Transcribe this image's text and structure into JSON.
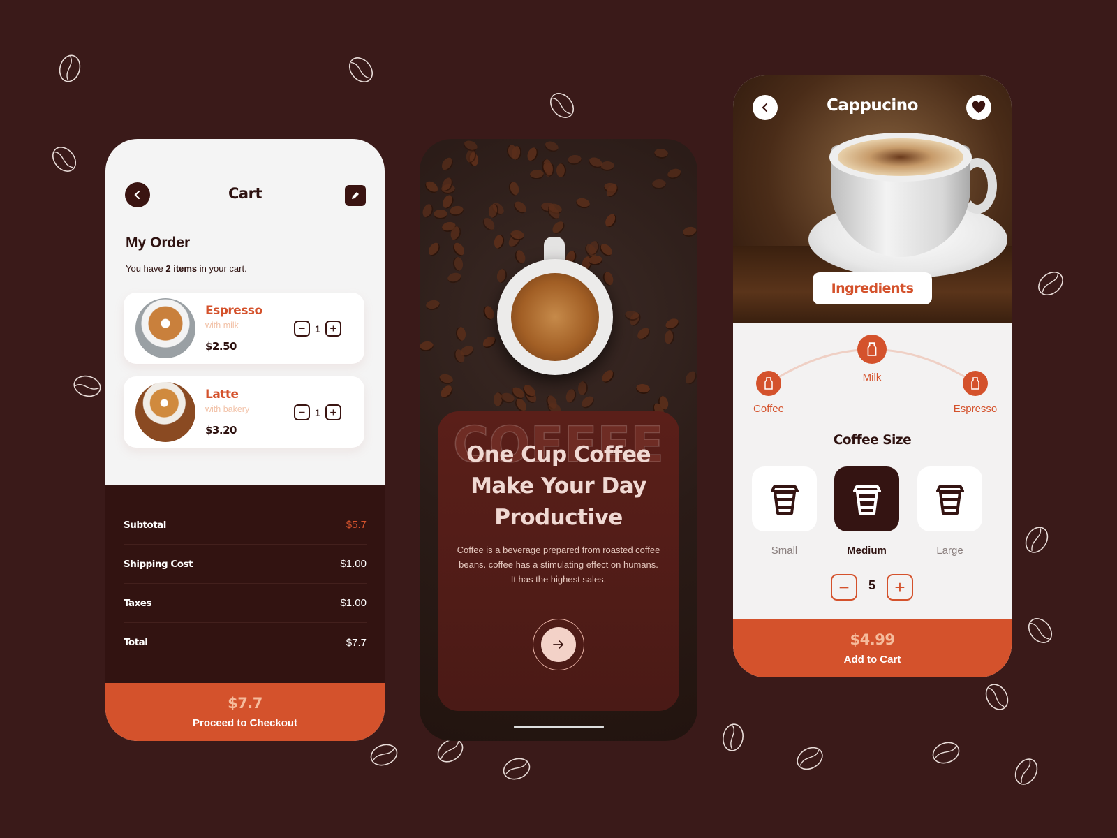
{
  "colors": {
    "background": "#3a1a19",
    "accent": "#d4522c",
    "dark": "#321311",
    "peach": "#f5bb9c"
  },
  "cart": {
    "title": "Cart",
    "back_icon": "chevron-left-icon",
    "edit_icon": "pencil-icon",
    "heading": "My Order",
    "subtitle_pre": "You have ",
    "subtitle_bold": "2 items",
    "subtitle_post": " in your cart.",
    "items": [
      {
        "name": "Espresso",
        "desc": "with milk",
        "price": "$2.50",
        "qty": "1"
      },
      {
        "name": "Latte",
        "desc": "with bakery",
        "price": "$3.20",
        "qty": "1"
      }
    ],
    "summary": [
      {
        "label": "Subtotal",
        "value": "$5.7"
      },
      {
        "label": "Shipping Cost",
        "value": "$1.00"
      },
      {
        "label": "Taxes",
        "value": "$1.00"
      },
      {
        "label": "Total",
        "value": "$7.7"
      }
    ],
    "checkout": {
      "amount": "$7.7",
      "label": "Proceed to Checkout"
    }
  },
  "onboarding": {
    "watermark": "COFFEE",
    "headline": [
      "One Cup Coffee",
      "Make Your Day",
      "Productive"
    ],
    "description": "Coffee is a beverage prepared from roasted coffee beans. coffee has a stimulating effect on humans. It has the highest sales.",
    "next_icon": "arrow-right-icon"
  },
  "detail": {
    "title": "Cappucino",
    "favorite_icon": "heart-icon",
    "ingredients_label": "Ingredients",
    "ingredients": [
      {
        "label": "Coffee",
        "icon": "bottle-icon"
      },
      {
        "label": "Milk",
        "icon": "bottle-icon",
        "selected": true
      },
      {
        "label": "Espresso",
        "icon": "bottle-icon"
      }
    ],
    "size_title": "Coffee Size",
    "sizes": [
      {
        "label": "Small",
        "icon": "cup-icon"
      },
      {
        "label": "Medium",
        "icon": "cup-icon",
        "selected": true
      },
      {
        "label": "Large",
        "icon": "cup-icon"
      }
    ],
    "quantity": "5",
    "price": "$4.99",
    "add_label": "Add to Cart"
  }
}
